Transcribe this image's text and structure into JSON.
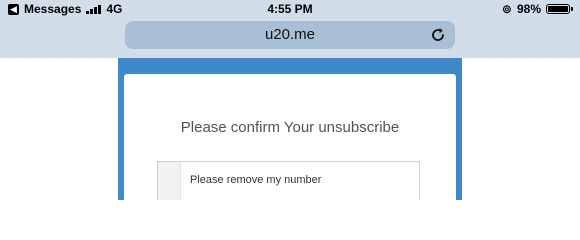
{
  "status_bar": {
    "back_app": "Messages",
    "network": "4G",
    "time": "4:55 PM",
    "battery_percent": "98%",
    "battery_level": 0.98,
    "signal_bars": 4
  },
  "browser": {
    "url": "u20.me",
    "reload_icon": "reload-icon"
  },
  "page": {
    "heading": "Please confirm Your unsubscribe",
    "message_value": "Please remove my number"
  },
  "colors": {
    "chrome_bg": "#d1dde9",
    "url_bar_bg": "#a9bfd5",
    "page_bg": "#3f89c8",
    "card_bg": "#ffffff"
  }
}
